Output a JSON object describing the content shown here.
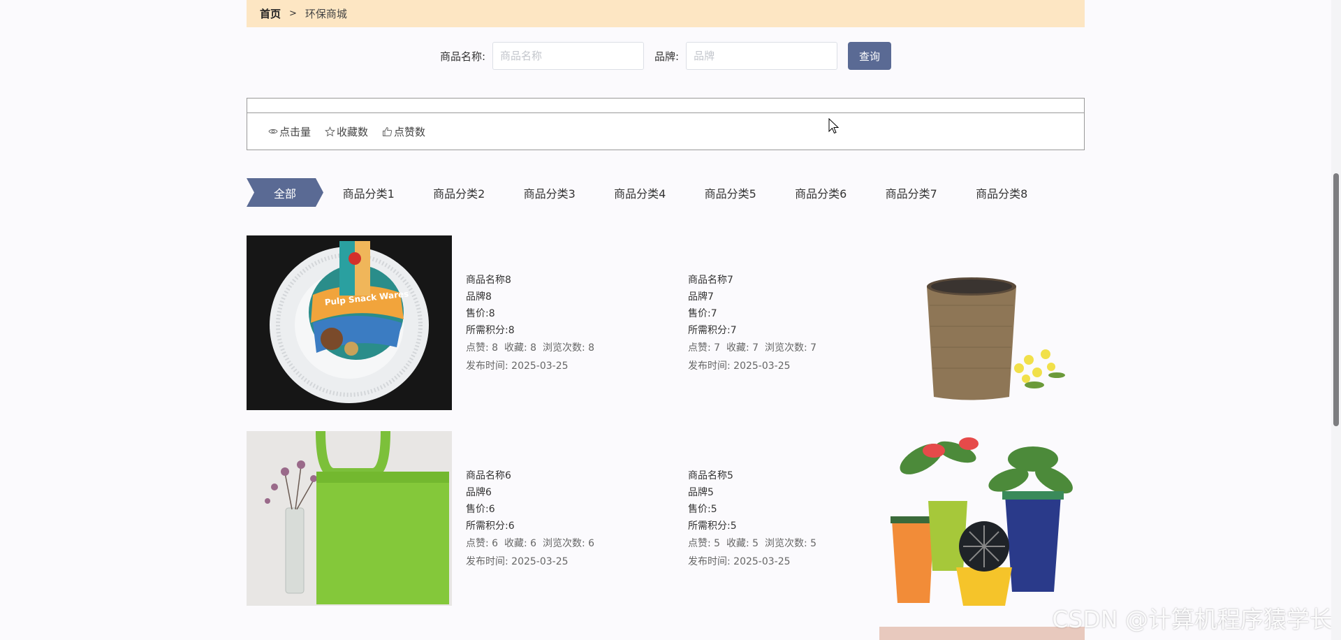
{
  "breadcrumb": {
    "home": "首页",
    "separator": ">",
    "current": "环保商城"
  },
  "search": {
    "name_label": "商品名称:",
    "name_placeholder": "商品名称",
    "brand_label": "品牌:",
    "brand_placeholder": "品牌",
    "button": "查询"
  },
  "sorts": [
    {
      "icon": "eye-icon",
      "label": "点击量"
    },
    {
      "icon": "star-icon",
      "label": "收藏数"
    },
    {
      "icon": "thumbs-up-icon",
      "label": "点赞数"
    }
  ],
  "categories": {
    "active": "全部",
    "items": [
      "商品分类1",
      "商品分类2",
      "商品分类3",
      "商品分类4",
      "商品分类5",
      "商品分类6",
      "商品分类7",
      "商品分类8"
    ]
  },
  "products": [
    {
      "name": "商品名称8",
      "brand": "品牌8",
      "price": "售价:8",
      "points": "所需积分:8",
      "stats": "点赞: 8  收藏: 8  浏览次数: 8",
      "date": "发布时间: 2025-03-25",
      "image": "paper-plate-image"
    },
    {
      "name": "商品名称7",
      "brand": "品牌7",
      "price": "售价:7",
      "points": "所需积分:7",
      "stats": "点赞: 7  收藏: 7  浏览次数: 7",
      "date": "发布时间: 2025-03-25",
      "image": "woven-basket-image"
    },
    {
      "name": "商品名称6",
      "brand": "品牌6",
      "price": "售价:6",
      "points": "所需积分:6",
      "stats": "点赞: 6  收藏: 6  浏览次数: 6",
      "date": "发布时间: 2025-03-25",
      "image": "green-tote-bag-image"
    },
    {
      "name": "商品名称5",
      "brand": "品牌5",
      "price": "售价:5",
      "points": "所需积分:5",
      "stats": "点赞: 5  收藏: 5  浏览次数: 5",
      "date": "发布时间: 2025-03-25",
      "image": "plant-pots-image"
    }
  ],
  "watermark": "CSDN @计算机程序猿学长",
  "colors": {
    "breadcrumb_bg": "#fde6c3",
    "accent": "#5a6a94"
  }
}
